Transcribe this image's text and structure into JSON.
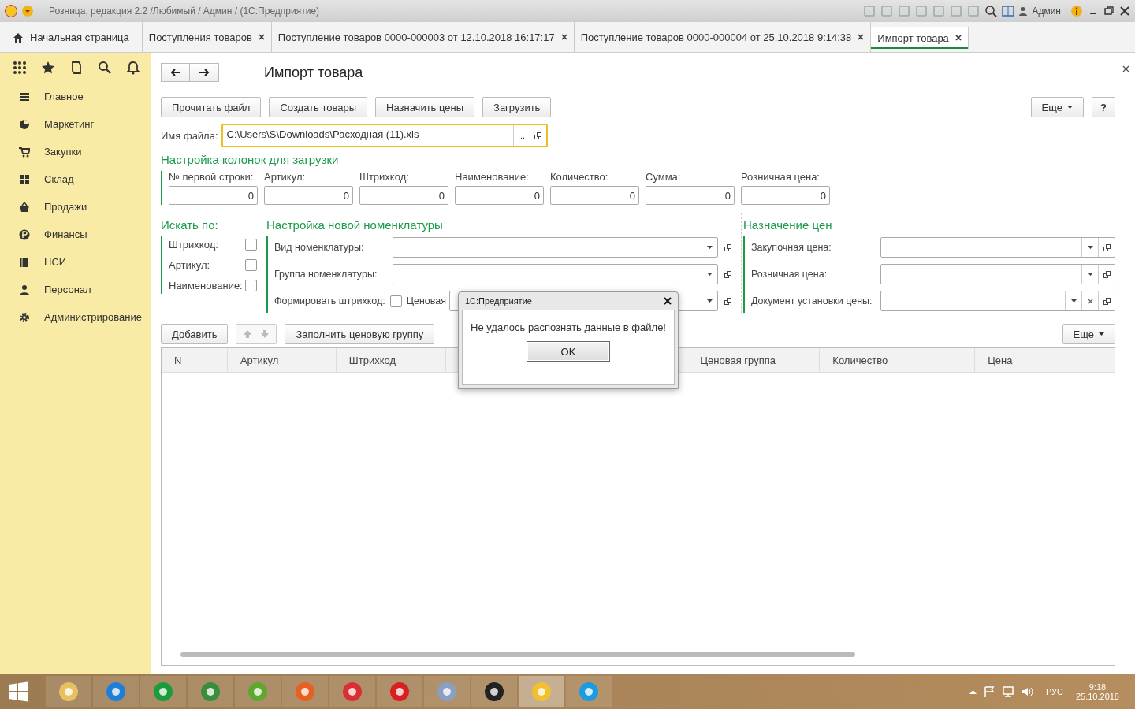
{
  "window": {
    "title": "Розница, редакция 2.2 /Любимый / Админ /  (1С:Предприятие)",
    "user": "Админ"
  },
  "tabs": [
    {
      "label": "Начальная страница",
      "kind": "home",
      "selected": false
    },
    {
      "label": "Поступления товаров",
      "kind": "doc",
      "selected": false
    },
    {
      "label": "Поступление товаров 0000-000003 от 12.10.2018 16:17:17",
      "kind": "doc",
      "selected": false
    },
    {
      "label": "Поступление товаров 0000-000004 от 25.10.2018 9:14:38",
      "kind": "doc",
      "selected": false
    },
    {
      "label": "Импорт товара",
      "kind": "doc",
      "selected": true
    }
  ],
  "sidebar": {
    "items": [
      {
        "label": "Главное"
      },
      {
        "label": "Маркетинг"
      },
      {
        "label": "Закупки"
      },
      {
        "label": "Склад"
      },
      {
        "label": "Продажи"
      },
      {
        "label": "Финансы"
      },
      {
        "label": "НСИ"
      },
      {
        "label": "Персонал"
      },
      {
        "label": "Администрирование"
      }
    ]
  },
  "form": {
    "title": "Импорт товара",
    "buttons": [
      "Прочитать файл",
      "Создать товары",
      "Назначить цены",
      "Загрузить"
    ],
    "more": "Еще",
    "help": "?",
    "file": {
      "label": "Имя файла:",
      "value": "C:\\Users\\S\\Downloads\\Расходная (11).xls",
      "choose": "..."
    },
    "columns_section": {
      "heading": "Настройка колонок для загрузки",
      "fields": [
        {
          "label": "№ первой строки:",
          "value": "0"
        },
        {
          "label": "Артикул:",
          "value": "0"
        },
        {
          "label": "Штрихкод:",
          "value": "0"
        },
        {
          "label": "Наименование:",
          "value": "0"
        },
        {
          "label": "Количество:",
          "value": "0"
        },
        {
          "label": "Сумма:",
          "value": "0"
        },
        {
          "label": "Розничная цена:",
          "value": "0"
        }
      ]
    },
    "search_section": {
      "heading": "Искать по:",
      "options": [
        {
          "label": "Штрихкод:",
          "checked": false
        },
        {
          "label": "Артикул:",
          "checked": false
        },
        {
          "label": "Наименование:",
          "checked": false
        }
      ]
    },
    "nomenclature_section": {
      "heading": "Настройка новой номенклатуры",
      "fields": [
        {
          "label": "Вид номенклатуры:"
        },
        {
          "label": "Группа номенклатуры:"
        }
      ],
      "barcode": {
        "label": "Формировать штрихкод:",
        "checked": false
      },
      "price_group_label": "Ценовая"
    },
    "prices_section": {
      "heading": "Назначение цен",
      "fields": [
        {
          "label": "Закупочная цена:",
          "clearable": false
        },
        {
          "label": "Розничная цена:",
          "clearable": false
        },
        {
          "label": "Документ установки цены:",
          "clearable": true
        }
      ]
    },
    "table_toolbar": {
      "add": "Добавить",
      "fill": "Заполнить ценовую группу",
      "more": "Еще"
    },
    "table": {
      "columns": [
        "N",
        "Артикул",
        "Штрихкод",
        "Ценовая группа",
        "Количество",
        "Цена"
      ]
    }
  },
  "dialog": {
    "title": "1С:Предприятие",
    "message": "Не удалось распознать данные в файле!",
    "button": "OK"
  },
  "taskbar": {
    "lang": "РУС",
    "time": "9:18",
    "date": "25.10.2018"
  }
}
